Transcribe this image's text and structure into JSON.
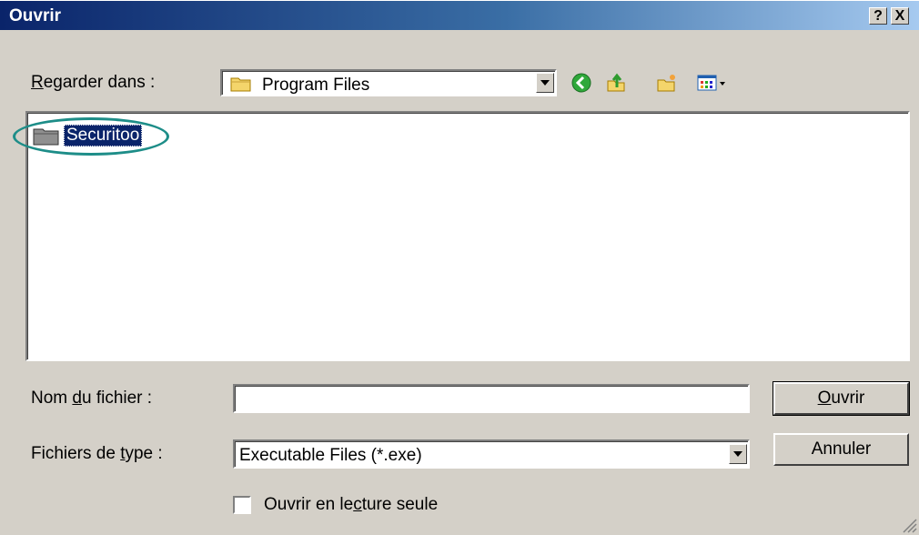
{
  "window": {
    "title": "Ouvrir",
    "help_label": "?",
    "close_label": "X"
  },
  "lookin": {
    "label_accel": "R",
    "label_rest": "egarder dans :",
    "value": "Program Files"
  },
  "toolbar": {
    "icons": [
      "back-icon",
      "up-folder-icon",
      "new-folder-icon",
      "view-menu-icon"
    ]
  },
  "files": [
    {
      "name": "Securitoo",
      "selected": true,
      "highlighted": true
    }
  ],
  "filename": {
    "label_pre": "Nom ",
    "label_accel": "d",
    "label_post": "u fichier :",
    "value": ""
  },
  "filetype": {
    "label_pre": "Fichiers de ",
    "label_accel": "t",
    "label_post": "ype :",
    "value": "Executable Files (*.exe)"
  },
  "buttons": {
    "open_accel": "O",
    "open_rest": "uvrir",
    "cancel": "Annuler"
  },
  "readonly": {
    "label_pre": "Ouvrir en le",
    "label_accel": "c",
    "label_post": "ture seule",
    "checked": false
  },
  "colors": {
    "title_start": "#0a246a",
    "title_end": "#a6caf0",
    "selection": "#0a246a",
    "highlight_ring": "#1d8d88"
  }
}
